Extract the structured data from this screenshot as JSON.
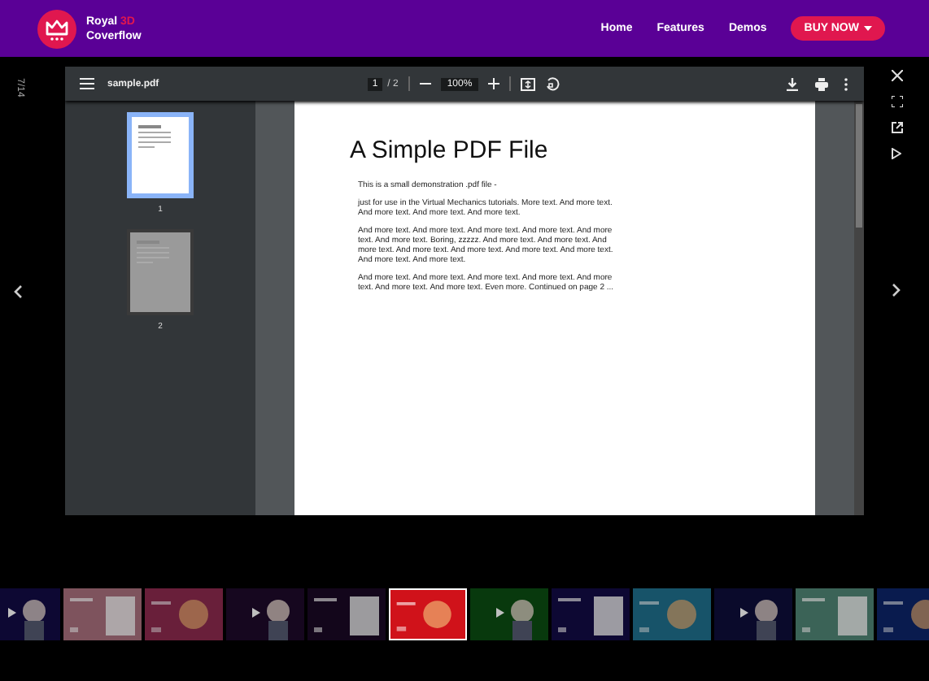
{
  "header": {
    "logo_line1": "Royal",
    "logo_accent": "3D",
    "logo_line2": "Coverflow",
    "nav": [
      "Home",
      "Features",
      "Demos"
    ],
    "cta": "BUY NOW"
  },
  "counter": "7/14",
  "viewer": {
    "filename": "sample.pdf",
    "page": "1",
    "pages": "/ 2",
    "zoom": "100%",
    "thumbnails": [
      {
        "label": "1",
        "selected": true
      },
      {
        "label": "2",
        "selected": false
      }
    ],
    "document": {
      "title": "A Simple PDF File",
      "paragraphs": [
        "This is a small demonstration .pdf file -",
        "just for use in the Virtual Mechanics tutorials. More text. And more text. And more text. And more text. And more text.",
        "And more text. And more text. And more text. And more text. And more text. And more text. Boring, zzzzz. And more text. And more text. And more text. And more text. And more text. And more text. And more text. And more text. And more text.",
        "And more text. And more text. And more text. And more text. And more text. And more text. And more text. Even more. Continued on page 2 ..."
      ]
    }
  },
  "filmstrip": [
    {
      "kind": "picture",
      "selected": false
    },
    {
      "kind": "picture",
      "selected": false
    },
    {
      "kind": "picture",
      "selected": false
    },
    {
      "kind": "picture",
      "selected": false
    },
    {
      "kind": "picture",
      "selected": false
    },
    {
      "kind": "picture",
      "selected": true
    },
    {
      "kind": "picture",
      "selected": false
    },
    {
      "kind": "picture",
      "selected": false
    },
    {
      "kind": "picture",
      "selected": false
    },
    {
      "kind": "picture",
      "selected": false
    },
    {
      "kind": "picture",
      "selected": false
    },
    {
      "kind": "picture",
      "selected": false
    }
  ]
}
